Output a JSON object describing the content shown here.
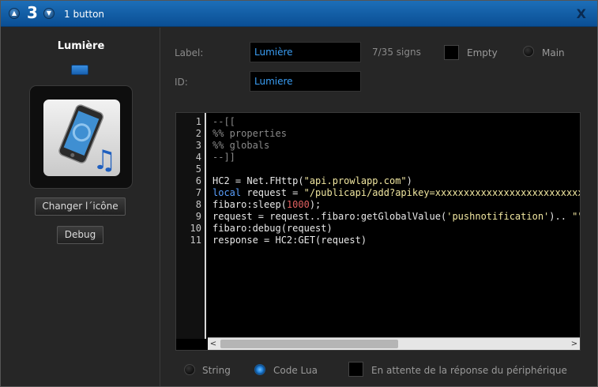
{
  "titlebar": {
    "room_number": "3",
    "title": "1 button",
    "close_glyph": "X",
    "up_glyph": "▲",
    "down_glyph": "▼"
  },
  "device": {
    "name": "Lumière",
    "icon": "smartphone-with-music-note-icon",
    "led_color": "#2a7fd4",
    "change_icon_label": "Changer l´icône",
    "debug_label": "Debug"
  },
  "form": {
    "label_caption": "Label:",
    "label_value": "Lumière",
    "sign_counter": "7/35 signs",
    "empty_label": "Empty",
    "main_label": "Main",
    "id_caption": "ID:",
    "id_value": "Lumiere"
  },
  "editor": {
    "line_numbers": [
      "1",
      "2",
      "3",
      "4",
      "5",
      "6",
      "7",
      "8",
      "9",
      "10",
      "11"
    ],
    "lines": [
      [
        {
          "t": "--[[",
          "c": "comment"
        }
      ],
      [
        {
          "t": "%% properties",
          "c": "comment"
        }
      ],
      [
        {
          "t": "%% globals",
          "c": "comment"
        }
      ],
      [
        {
          "t": "--]]",
          "c": "comment"
        }
      ],
      [],
      [
        {
          "t": "HC2 = Net.FHttp(",
          "c": "plain"
        },
        {
          "t": "\"api.prowlapp.com\"",
          "c": "str"
        },
        {
          "t": ")",
          "c": "plain"
        }
      ],
      [
        {
          "t": "local",
          "c": "kw"
        },
        {
          "t": " request = ",
          "c": "plain"
        },
        {
          "t": "\"/publicapi/add?apikey=xxxxxxxxxxxxxxxxxxxxxxxxxxxxxxxx",
          "c": "str"
        }
      ],
      [
        {
          "t": "fibaro:sleep(",
          "c": "plain"
        },
        {
          "t": "1000",
          "c": "num"
        },
        {
          "t": ");",
          "c": "plain"
        }
      ],
      [
        {
          "t": "request = request..fibaro:getGlobalValue(",
          "c": "plain"
        },
        {
          "t": "'pushnotification'",
          "c": "str"
        },
        {
          "t": ").. ",
          "c": "plain"
        },
        {
          "t": "\"\"",
          "c": "str"
        },
        {
          "t": ";",
          "c": "plain"
        }
      ],
      [
        {
          "t": "fibaro:debug(request)",
          "c": "plain"
        }
      ],
      [
        {
          "t": "response = HC2:GET(request)",
          "c": "plain"
        }
      ]
    ],
    "scroll_left_glyph": "<",
    "scroll_right_glyph": ">"
  },
  "footer": {
    "string_label": "String",
    "codelua_label": "Code Lua",
    "waiting_label": "En attente de la réponse du périphérique",
    "selected_mode": "Code Lua"
  }
}
